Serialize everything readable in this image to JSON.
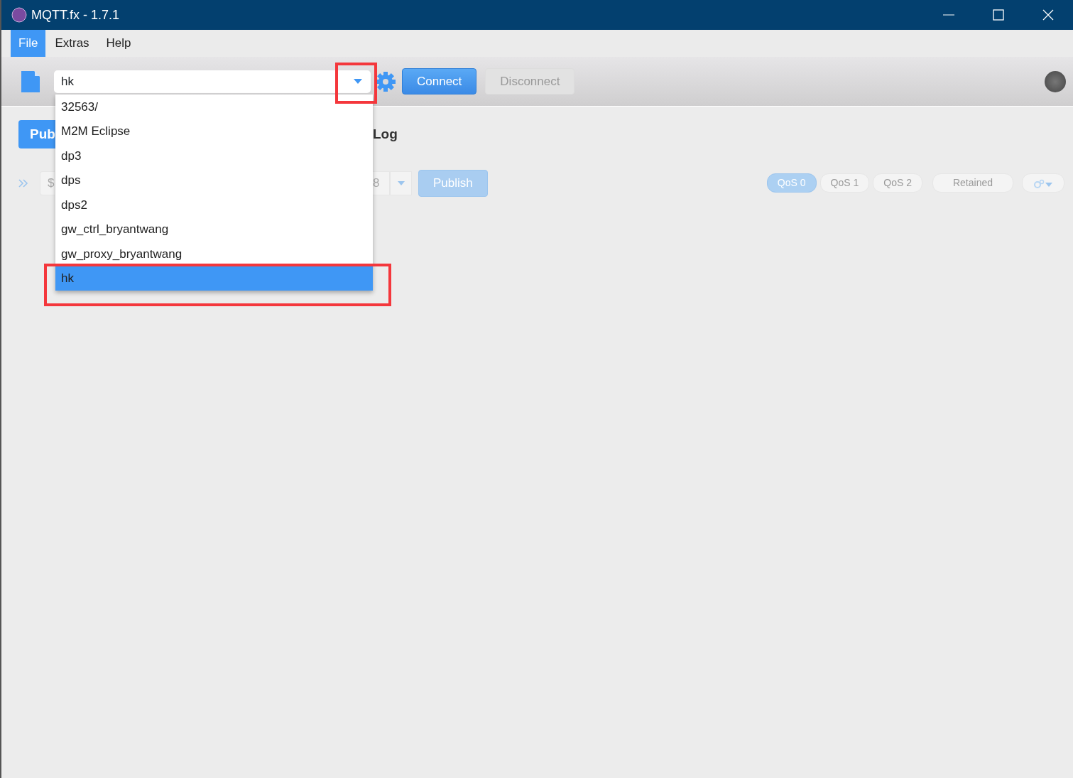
{
  "window": {
    "title": "MQTT.fx - 1.7.1"
  },
  "menu": [
    {
      "label": "File",
      "selected": true
    },
    {
      "label": "Extras",
      "selected": false
    },
    {
      "label": "Help",
      "selected": false
    }
  ],
  "toolbar": {
    "profile_combo": {
      "value": "hk"
    },
    "buttons": [
      {
        "label": "Connect",
        "disabled": false
      },
      {
        "label": "Disconnect",
        "disabled": true
      }
    ],
    "connected": false
  },
  "tabs": [
    {
      "label": "Pub",
      "selected": true
    },
    {
      "label": "Log",
      "selected": false
    }
  ],
  "publish_bar": {
    "topic_field_start": "$",
    "topic_field_end": "8",
    "publish_button": "Publish",
    "qos": [
      {
        "label": "QoS 0",
        "selected": true
      },
      {
        "label": "QoS 1",
        "selected": false
      },
      {
        "label": "QoS 2",
        "selected": false
      }
    ],
    "retained": {
      "label": "Retained",
      "selected": false
    }
  },
  "dropdown": {
    "options": [
      {
        "label": "32563/",
        "selected": false
      },
      {
        "label": "M2M Eclipse",
        "selected": false
      },
      {
        "label": "dp3",
        "selected": false
      },
      {
        "label": "dps",
        "selected": false
      },
      {
        "label": "dps2",
        "selected": false
      },
      {
        "label": "gw_ctrl_bryantwang",
        "selected": false
      },
      {
        "label": "gw_proxy_bryantwang",
        "selected": false
      },
      {
        "label": "hk",
        "selected": true
      }
    ]
  },
  "annotations": [
    {
      "kind": "rectangle",
      "color": "#f4373c"
    },
    {
      "kind": "rectangle",
      "color": "#f4373c"
    }
  ]
}
